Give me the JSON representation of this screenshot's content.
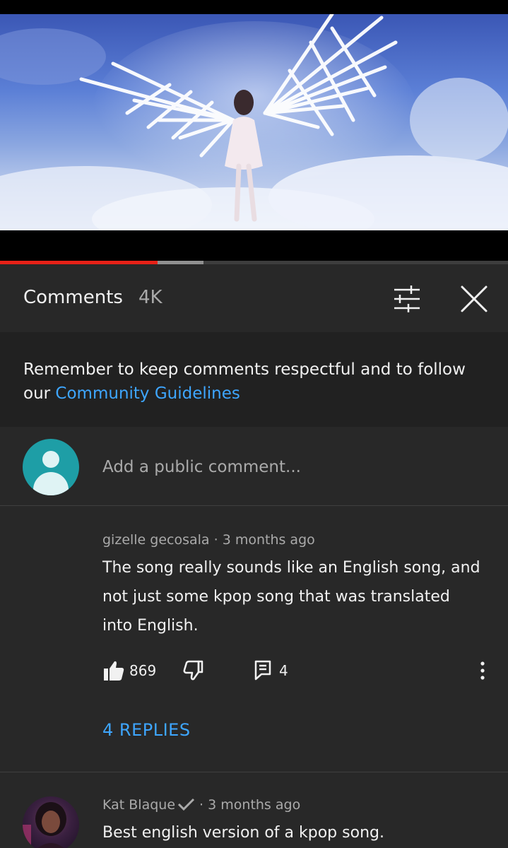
{
  "video": {
    "progress_played": 0.31,
    "progress_buffered": 0.4,
    "colors": {
      "played": "#e62117",
      "buffered": "#909090"
    }
  },
  "comments_header": {
    "title": "Comments",
    "count": "4K",
    "sort_icon": "sliders-icon",
    "close_icon": "close-icon"
  },
  "notice": {
    "text": "Remember to keep comments respectful and to follow our ",
    "link": "Community Guidelines"
  },
  "add_comment": {
    "placeholder": "Add a public comment..."
  },
  "comments": [
    {
      "author": "gizelle gecosala",
      "time": "3 months ago",
      "text": "The song really sounds like an English song, and not just some kpop song that was translated into English.",
      "likes": "869",
      "reply_count": "4",
      "replies_link": "4 REPLIES"
    },
    {
      "author": "Kat Blaque",
      "verified": true,
      "time": "3 months ago",
      "text": "Best english version of a kpop song."
    }
  ],
  "separator": " · ",
  "accent_link_color": "#3ea6ff"
}
